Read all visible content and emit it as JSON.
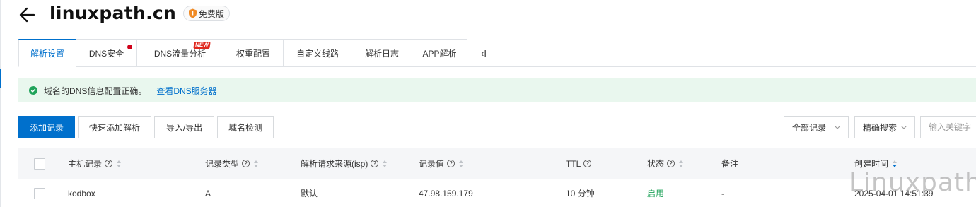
{
  "header": {
    "title": "linuxpath.cn",
    "badge": "免费版"
  },
  "tabs": [
    {
      "label": "解析设置"
    },
    {
      "label": "DNS安全"
    },
    {
      "label": "DNS流量分析",
      "tag": "NEW"
    },
    {
      "label": "权重配置"
    },
    {
      "label": "自定义线路"
    },
    {
      "label": "解析日志"
    },
    {
      "label": "APP解析"
    }
  ],
  "tabs_collapse": "‹I",
  "alert": {
    "message": "域名的DNS信息配置正确。",
    "link": "查看DNS服务器"
  },
  "toolbar": {
    "add": "添加记录",
    "quick_add": "快速添加解析",
    "import_export": "导入/导出",
    "check": "域名检测",
    "filter_all": "全部记录",
    "search_mode": "精确搜索",
    "search_placeholder": "输入关键字"
  },
  "table": {
    "columns": {
      "host": "主机记录",
      "type": "记录类型",
      "isp": "解析请求来源(isp)",
      "value": "记录值",
      "ttl": "TTL",
      "status": "状态",
      "remark": "备注",
      "created": "创建时间"
    },
    "rows": [
      {
        "host": "kodbox",
        "type": "A",
        "isp": "默认",
        "value": "47.98.159.179",
        "ttl": "10 分钟",
        "status": "启用",
        "remark": "-",
        "created": "2025-04-01 14:51:39"
      }
    ]
  },
  "watermark": "Linuxpath",
  "colors": {
    "primary": "#0070cc",
    "success": "#20a35a",
    "alert_bg": "#e9f7ee",
    "header_bg": "#f5f6f8"
  }
}
